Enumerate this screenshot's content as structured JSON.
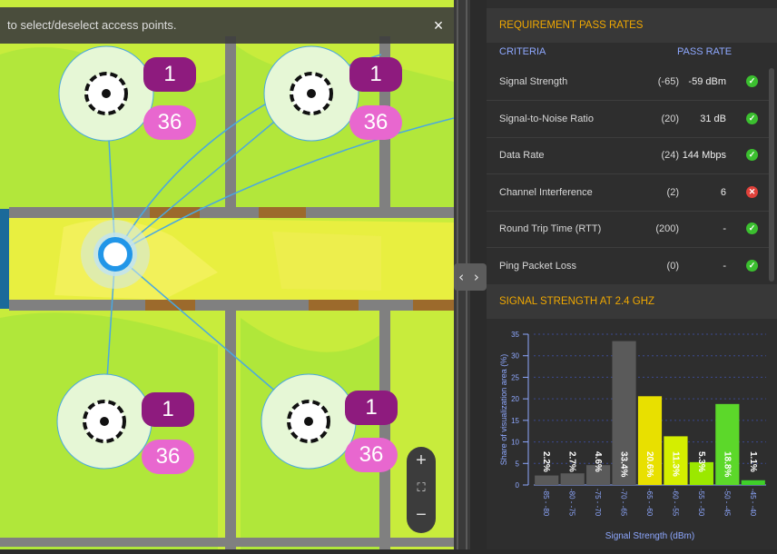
{
  "map": {
    "instruction": "to select/deselect access points.",
    "close_glyph": "×",
    "access_points": [
      {
        "count": "1",
        "channel": "36"
      },
      {
        "count": "1",
        "channel": "36"
      },
      {
        "count": "1",
        "channel": "36"
      },
      {
        "count": "1",
        "channel": "36"
      }
    ],
    "zoom": {
      "in": "+",
      "fit": "⛶",
      "out": "−"
    }
  },
  "divider_toggle": "‹ ›",
  "requirements": {
    "title": "REQUIREMENT PASS RATES",
    "col_criteria": "CRITERIA",
    "col_pass_rate": "PASS RATE",
    "rows": [
      {
        "name": "Signal Strength",
        "required": "(-65)",
        "value": "-59 dBm",
        "status": "pass"
      },
      {
        "name": "Signal-to-Noise Ratio",
        "required": "(20)",
        "value": "31 dB",
        "status": "pass"
      },
      {
        "name": "Data Rate",
        "required": "(24)",
        "value": "144 Mbps",
        "status": "pass"
      },
      {
        "name": "Channel Interference",
        "required": "(2)",
        "value": "6",
        "status": "fail"
      },
      {
        "name": "Round Trip Time (RTT)",
        "required": "(200)",
        "value": "-",
        "status": "pass"
      },
      {
        "name": "Ping Packet Loss",
        "required": "(0)",
        "value": "-",
        "status": "pass"
      }
    ]
  },
  "signal_section": {
    "title": "SIGNAL STRENGTH AT 2.4 GHZ"
  },
  "chart_data": {
    "type": "bar",
    "title": "",
    "xlabel": "Signal Strength (dBm)",
    "ylabel": "Share of visualization area (%)",
    "ylim": [
      0,
      35
    ],
    "yticks": [
      0,
      5,
      10,
      15,
      20,
      25,
      30,
      35
    ],
    "grid": true,
    "categories": [
      "-85 - -80",
      "-80 - -75",
      "-75 - -70",
      "-70 - -65",
      "-65 - -60",
      "-60 - -55",
      "-55 - -50",
      "-50 - -45",
      "-45 - -40"
    ],
    "values": [
      2.2,
      2.7,
      4.6,
      33.4,
      20.6,
      11.3,
      5.3,
      18.8,
      1.1
    ],
    "labels": [
      "2.2%",
      "2.7%",
      "4.6%",
      "33.4%",
      "20.6%",
      "11.3%",
      "5.3%",
      "18.8%",
      "1.1%"
    ],
    "colors": [
      "#5a5a5a",
      "#5a5a5a",
      "#5a5a5a",
      "#5a5a5a",
      "#e8e000",
      "#d4ee00",
      "#9be800",
      "#5cd82a",
      "#3fcf2a"
    ]
  },
  "colors": {
    "accent": "#f0a800",
    "axis": "#8ea8ff",
    "pass": "#3bbf2f",
    "fail": "#e0413a"
  }
}
